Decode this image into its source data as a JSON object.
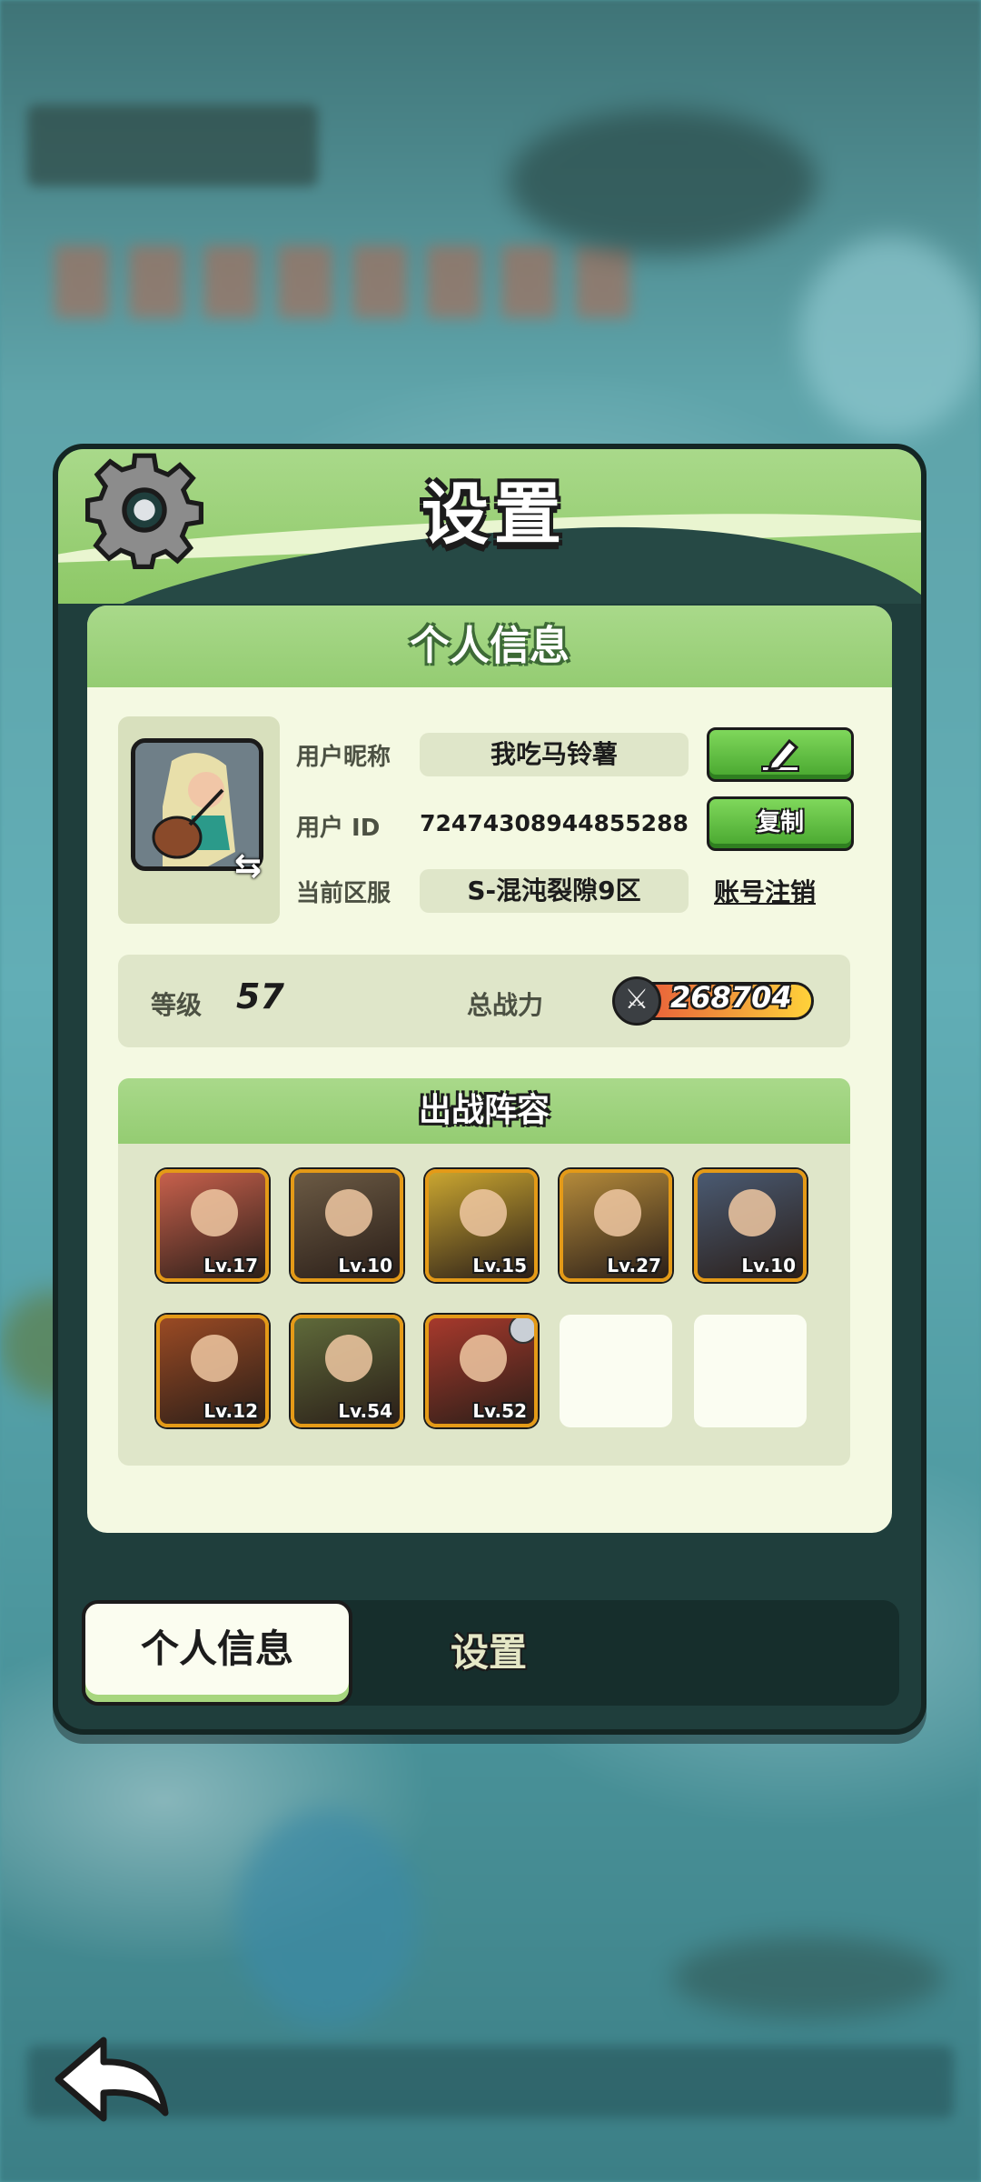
{
  "dialog": {
    "title": "设置"
  },
  "info": {
    "section_title": "个人信息",
    "nickname_label": "用户昵称",
    "nickname": "我吃马铃薯",
    "id_label": "用户  ID",
    "user_id": "72474308944855288",
    "copy_label": "复制",
    "server_label": "当前区服",
    "server": "S-混沌裂隙9区",
    "delete_account_label": "账号注销",
    "level_label": "等级",
    "level": "57",
    "power_label": "总战力",
    "power": "268704"
  },
  "lineup": {
    "title": "出战阵容",
    "heroes": [
      {
        "level": "Lv.17",
        "color": "#c7604c"
      },
      {
        "level": "Lv.10",
        "color": "#6b5a44"
      },
      {
        "level": "Lv.15",
        "color": "#c9a530"
      },
      {
        "level": "Lv.27",
        "color": "#b48a3a"
      },
      {
        "level": "Lv.10",
        "color": "#4a5a72"
      },
      {
        "level": "Lv.12",
        "color": "#9a4a24"
      },
      {
        "level": "Lv.54",
        "color": "#5f6a3a"
      },
      {
        "level": "Lv.52",
        "color": "#a7392c"
      }
    ],
    "empty_slots": 2
  },
  "tabs": {
    "active": "个人信息",
    "inactive": "设置"
  },
  "icons": {
    "settings": "gear-icon",
    "edit": "pencil-icon",
    "swap_avatar": "swap-arrows-icon",
    "power": "crossed-swords-icon",
    "back": "back-arrow-icon"
  },
  "colors": {
    "accent_green": "#8dc866",
    "button_green": "#47a62e",
    "panel_dark": "#1f3e3c",
    "card_bg": "#f4f9e2",
    "hero_frame": "#e49a17"
  }
}
